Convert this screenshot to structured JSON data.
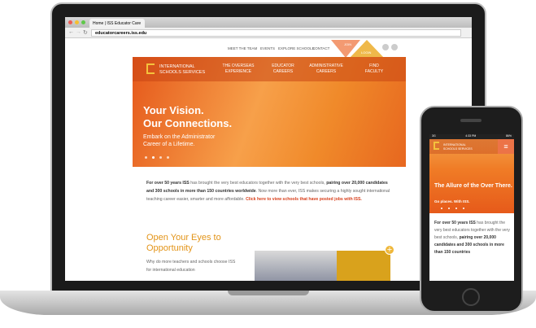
{
  "browser": {
    "tab_title": "Home | ISS Educator Care",
    "url": "educatorcareers.iss.edu"
  },
  "site": {
    "top_nav": [
      "MEET THE TEAM",
      "EVENTS",
      "EXPLORE SCHOOLS",
      "CONTACT"
    ],
    "join": "JOIN",
    "login": "LOGIN",
    "logo_line1": "INTERNATIONAL",
    "logo_line2": "SCHOOLS SERVICES",
    "main_nav": [
      {
        "l1": "THE OVERSEAS",
        "l2": "EXPERIENCE"
      },
      {
        "l1": "EDUCATOR",
        "l2": "CAREERS"
      },
      {
        "l1": "ADMINISTRATIVE",
        "l2": "CAREERS"
      },
      {
        "l1": "FIND",
        "l2": "FACULTY"
      }
    ],
    "hero_title1": "Your Vision.",
    "hero_title2": "Our Connections.",
    "hero_sub1": "Embark on the Administrator",
    "hero_sub2": "Career of a Lifetime.",
    "intro_bold1": "For over 50 years ISS",
    "intro_1": " has brought the very best educators together with the very best schools, ",
    "intro_bold2": "pairing over 20,000 candidates and 300 schools in more than 150 countries worldwide",
    "intro_2": ". Now more than ever, ISS makes securing a highly sought international teaching career easier, smarter and more affordable. ",
    "intro_link": "Click here to view schools that have posted jobs with ISS.",
    "section_title": "Open Your Eyes to Opportunity",
    "section_body": "Why do more teachers and schools choose ISS for international education"
  },
  "mobile": {
    "carrier": "3G",
    "time": "4:33 PM",
    "battery": "86%",
    "hero_title": "The Allure of the Over There.",
    "hero_sub": "Go places. With ISS.",
    "intro_bold1": "For over 50 years ISS",
    "intro_1": " has brought the very best educators together with the very best schools, ",
    "intro_bold2": "pairing over 20,000 candidates and 300 schools in more than 150 countries"
  }
}
